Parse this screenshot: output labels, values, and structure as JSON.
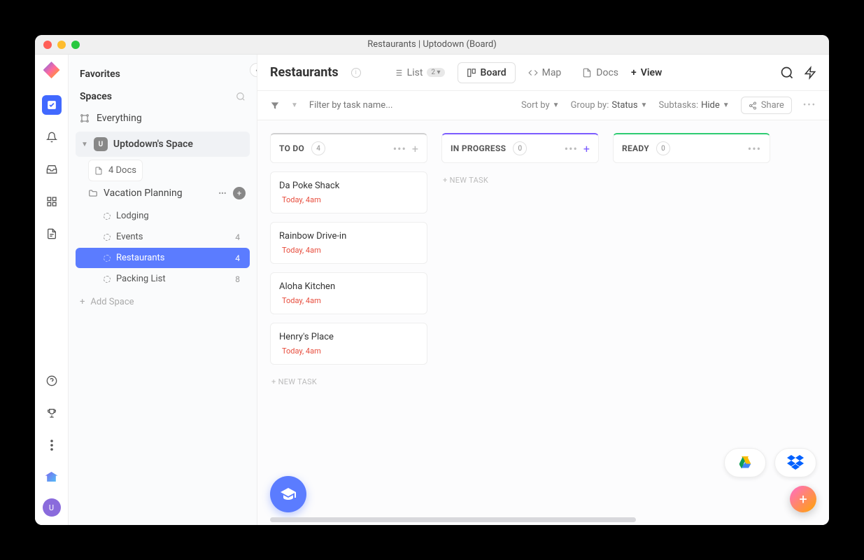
{
  "window": {
    "title": "Restaurants | Uptodown (Board)"
  },
  "sidebar": {
    "favorites": "Favorites",
    "spaces": "Spaces",
    "everything": "Everything",
    "space": {
      "initial": "U",
      "name": "Uptodown's Space"
    },
    "docs": {
      "label": "4 Docs"
    },
    "folder": {
      "name": "Vacation Planning"
    },
    "lists": [
      {
        "name": "Lodging",
        "count": ""
      },
      {
        "name": "Events",
        "count": "4"
      },
      {
        "name": "Restaurants",
        "count": "4"
      },
      {
        "name": "Packing List",
        "count": "8"
      }
    ],
    "add_space": "Add Space"
  },
  "header": {
    "title": "Restaurants",
    "tabs": {
      "list": "List",
      "list_badge": "2 ▾",
      "board": "Board",
      "map": "Map",
      "docs": "Docs",
      "view": "View"
    }
  },
  "toolbar": {
    "filter_placeholder": "Filter by task name...",
    "sort": "Sort by",
    "group_label": "Group by:",
    "group_value": "Status",
    "subtasks_label": "Subtasks:",
    "subtasks_value": "Hide",
    "share": "Share"
  },
  "columns": [
    {
      "key": "todo",
      "title": "TO DO",
      "count": "4",
      "accent": "todo",
      "tasks": [
        {
          "title": "Da Poke Shack",
          "date": "Today, 4am"
        },
        {
          "title": "Rainbow Drive-in",
          "date": "Today, 4am"
        },
        {
          "title": "Aloha Kitchen",
          "date": "Today, 4am"
        },
        {
          "title": "Henry's Place",
          "date": "Today, 4am"
        }
      ],
      "new_task": "+ NEW TASK"
    },
    {
      "key": "progress",
      "title": "IN PROGRESS",
      "count": "0",
      "accent": "progress",
      "tasks": [],
      "new_task": "+ NEW TASK"
    },
    {
      "key": "ready",
      "title": "READY",
      "count": "0",
      "accent": "ready",
      "tasks": [],
      "new_task": ""
    }
  ],
  "avatar": {
    "initial": "U"
  }
}
